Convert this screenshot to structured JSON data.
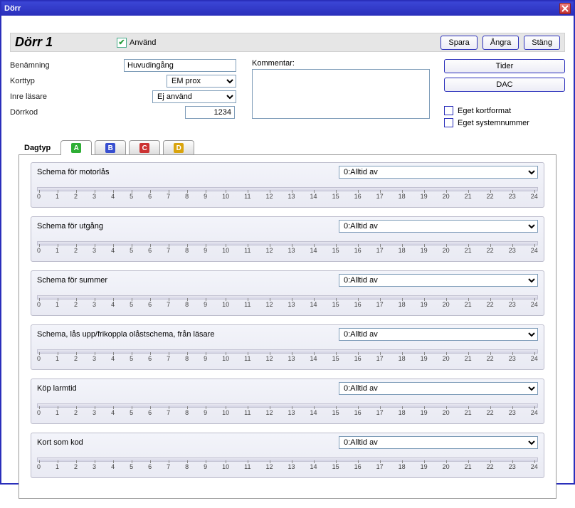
{
  "window": {
    "title": "Dörr"
  },
  "header": {
    "doorName": "Dörr 1",
    "useLabel": "Använd",
    "save": "Spara",
    "undo": "Ångra",
    "close": "Stäng"
  },
  "form": {
    "nameLabel": "Benämning",
    "nameValue": "Huvudingång",
    "cardTypeLabel": "Korttyp",
    "cardTypeValue": "EM prox",
    "innerReaderLabel": "Inre läsare",
    "innerReaderValue": "Ej använd",
    "doorCodeLabel": "Dörrkod",
    "doorCodeValue": "1234",
    "commentLabel": "Kommentar:",
    "commentValue": ""
  },
  "right": {
    "timesBtn": "Tider",
    "dacBtn": "DAC",
    "ownCardFormat": "Eget kortformat",
    "ownSystemNumber": "Eget systemnummer"
  },
  "tabs": {
    "label": "Dagtyp",
    "a": "A",
    "b": "B",
    "c": "C",
    "d": "D"
  },
  "hours": [
    "0",
    "1",
    "2",
    "3",
    "4",
    "5",
    "6",
    "7",
    "8",
    "9",
    "10",
    "11",
    "12",
    "13",
    "14",
    "15",
    "16",
    "17",
    "18",
    "19",
    "20",
    "21",
    "22",
    "23",
    "24"
  ],
  "scheduleOptions": [
    "0:Alltid av"
  ],
  "schedules": [
    {
      "label": "Schema för motorlås",
      "value": "0:Alltid av"
    },
    {
      "label": "Schema för utgång",
      "value": "0:Alltid av"
    },
    {
      "label": "Schema för summer",
      "value": "0:Alltid av"
    },
    {
      "label": "Schema, lås upp/frikoppla olåstschema, från läsare",
      "value": "0:Alltid av"
    },
    {
      "label": "Köp larmtid",
      "value": "0:Alltid av"
    },
    {
      "label": "Kort som kod",
      "value": "0:Alltid av"
    }
  ]
}
